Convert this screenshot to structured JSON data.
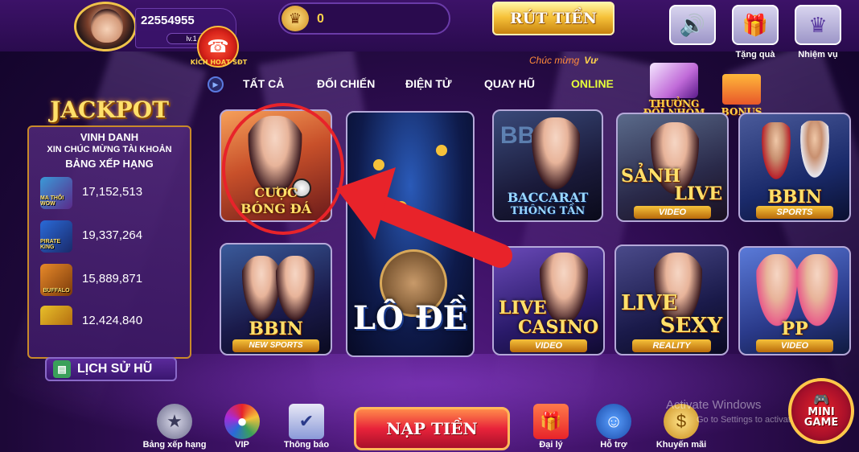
{
  "user": {
    "id": "22554955",
    "level": "lv.1",
    "hotline_label": "KÍCH HOẠT SĐT"
  },
  "coins": {
    "value": "0"
  },
  "withdraw_label": "RÚT TIỀN",
  "top_icons": [
    {
      "name": "speaker-icon",
      "label": ""
    },
    {
      "name": "gift-icon",
      "label": "Tặng quà"
    },
    {
      "name": "crown-icon",
      "label": "Nhiệm vụ"
    }
  ],
  "congrats": {
    "text": "Chúc mừng",
    "name": "Vư"
  },
  "tabs": [
    {
      "label": "TẤT CẢ",
      "active": false
    },
    {
      "label": "ĐỐI CHIẾN",
      "active": false
    },
    {
      "label": "ĐIỆN TỬ",
      "active": false
    },
    {
      "label": "QUAY HŨ",
      "active": false
    },
    {
      "label": "ONLINE",
      "active": true
    }
  ],
  "promos": {
    "team": "THƯỞNG ĐỘI NHÓM",
    "bonus": "BONUS"
  },
  "jackpot": {
    "title": "JACKPOT",
    "subtitle1": "VINH DANH",
    "subtitle2": "XIN CHÚC MỪNG TÀI KHOẢN",
    "subtitle3": "BẢNG XẾP HẠNG",
    "rows": [
      {
        "game": "MA THỔI WOW",
        "value": "17,152,513"
      },
      {
        "game": "PIRATE KING",
        "value": "19,337,264"
      },
      {
        "game": "BUFFALO",
        "value": "15,889,871"
      },
      {
        "game": "",
        "value": "12,424,840"
      }
    ],
    "history_label": "LỊCH SỬ HŨ"
  },
  "games": {
    "football": {
      "line1": "CƯỢC",
      "line2": "BÓNG ĐÁ"
    },
    "lode": {
      "label": "LÔ ĐỀ"
    },
    "baccarat": {
      "line1": "BACCARAT",
      "line2": "THÔNG TẦN",
      "brand": "BBIN"
    },
    "live": {
      "line1": "SẢNH",
      "line2": "LIVE",
      "sub": "VIDEO"
    },
    "bbin_sports": {
      "label": "BBIN",
      "sub": "SPORTS"
    },
    "bbin_new": {
      "label": "BBIN",
      "sub": "NEW SPORTS"
    },
    "live_casino": {
      "line1": "LIVE",
      "line2": "CASINO",
      "sub": "VIDEO"
    },
    "live_sexy": {
      "line1": "LIVE",
      "line2": "SEXY",
      "sub": "REALITY"
    },
    "pp": {
      "label": "PP",
      "sub": "VIDEO"
    }
  },
  "bottom": {
    "ranking": "Bảng xếp hạng",
    "vip": "VIP",
    "notice": "Thông báo",
    "deposit": "NẠP TIỀN",
    "agent": "Đại lý",
    "support": "Hỗ trợ",
    "promo": "Khuyến mãi",
    "mini_line1": "MINI",
    "mini_line2": "GAME"
  },
  "watermark": {
    "line1": "Activate Windows",
    "line2": "Go to Settings to activate Windows."
  },
  "colors": {
    "accent": "#ffd34a",
    "active_tab": "#e6ff3a",
    "annotation": "#e8232a"
  }
}
